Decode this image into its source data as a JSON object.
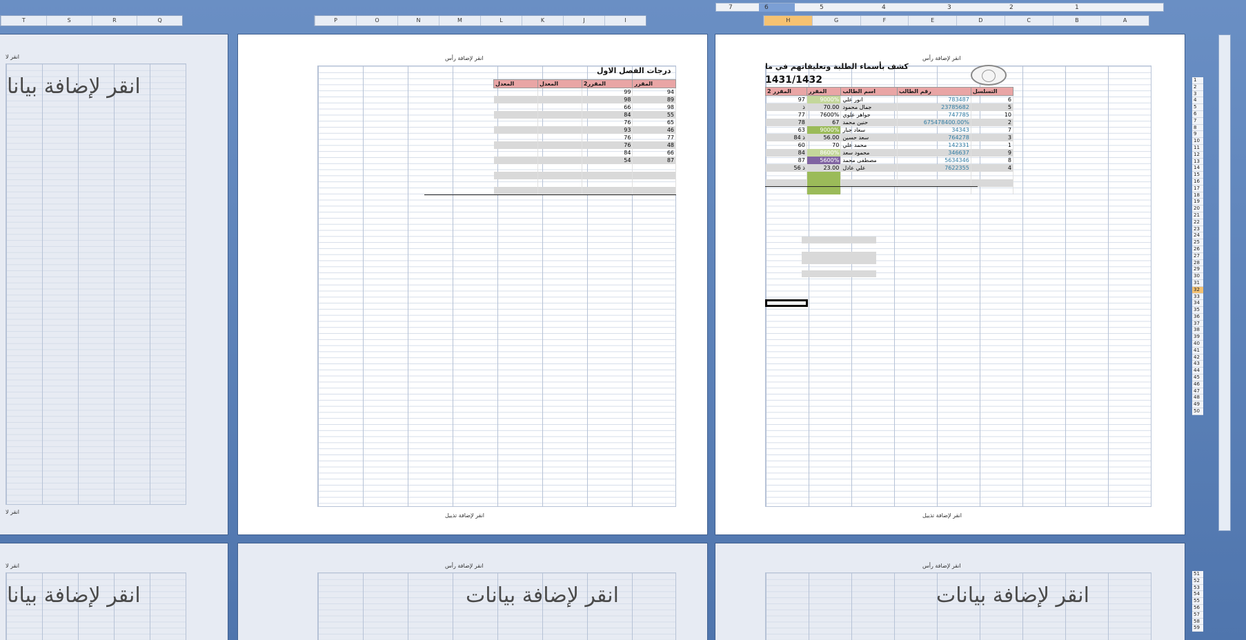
{
  "column_headers": {
    "left": [
      "T",
      "S",
      "R",
      "Q"
    ],
    "middle": [
      "P",
      "O",
      "N",
      "M",
      "L",
      "K",
      "J",
      "I"
    ],
    "right": [
      "H",
      "G",
      "F",
      "E",
      "D",
      "C",
      "B",
      "A"
    ],
    "selected": "H"
  },
  "ruler": [
    "7",
    "6",
    "5",
    "4",
    "3",
    "2",
    "1"
  ],
  "rows_top": [
    "1",
    "2",
    "3",
    "4",
    "5",
    "6",
    "7",
    "8",
    "9",
    "10",
    "11",
    "12",
    "13",
    "14",
    "15",
    "16",
    "17",
    "18",
    "19",
    "20",
    "21",
    "22",
    "23",
    "24",
    "25",
    "26",
    "27",
    "28",
    "29",
    "30",
    "31",
    "32",
    "33",
    "34",
    "35",
    "36",
    "37",
    "38",
    "39",
    "40",
    "41",
    "42",
    "43",
    "44",
    "45",
    "46",
    "47",
    "48",
    "49",
    "50"
  ],
  "rows_bottom": [
    "51",
    "52",
    "53",
    "54",
    "55",
    "56",
    "57",
    "58",
    "59"
  ],
  "selected_row": "32",
  "page_text": {
    "header": "انقر لإضافة رأس",
    "header_cut": "انقر لا",
    "footer": "انقر لإضافة تذييل",
    "footer_cut": "انقر لا",
    "add_data": "انقر لإضافة بيانات",
    "add_data_cut": "انقر لإضافة بيانا"
  },
  "page1": {
    "title": "كشف بأسماء الطلبة وتعليقاتهم في ما",
    "year": "1431/1432",
    "headers": [
      "التسلسل",
      "رقم الطالب",
      "اسم الطالب",
      "المقرر",
      "المقرر 2"
    ],
    "rows": [
      [
        "6",
        "783487",
        "انور علي",
        "9000%",
        "97"
      ],
      [
        "5",
        "23785682",
        "جمال محمود",
        "70.00",
        "ذ"
      ],
      [
        "10",
        "747785",
        "جواهر علوي",
        "7600%",
        "77"
      ],
      [
        "2",
        "675478400.00%",
        "حنين محمد",
        "67",
        "78"
      ],
      [
        "7",
        "34343",
        "سعاد جبار",
        "9000%",
        "63"
      ],
      [
        "3",
        "764278",
        "سعد حسين",
        "56.00",
        "84 ذ"
      ],
      [
        "1",
        "142331",
        "محمد علي",
        "70",
        "60"
      ],
      [
        "9",
        "346637",
        "محمود سعد",
        "8600%",
        "84"
      ],
      [
        "8",
        "5634346",
        "مصطفى محمد",
        "5600%",
        "87"
      ],
      [
        "4",
        "7622355",
        "علي عادل",
        "23.00",
        "56 ذ"
      ]
    ]
  },
  "page2": {
    "title": "درجات الفصل الاول",
    "headers": [
      "المقرر",
      "المقرر2",
      "المعدل",
      "المعدل"
    ],
    "rows": [
      [
        "94",
        "99"
      ],
      [
        "89",
        "98"
      ],
      [
        "98",
        "66"
      ],
      [
        "55",
        "84"
      ],
      [
        "65",
        "76"
      ],
      [
        "46",
        "93"
      ],
      [
        "77",
        "76"
      ],
      [
        "48",
        "76"
      ],
      [
        "66",
        "84"
      ],
      [
        "87",
        "54"
      ]
    ]
  }
}
